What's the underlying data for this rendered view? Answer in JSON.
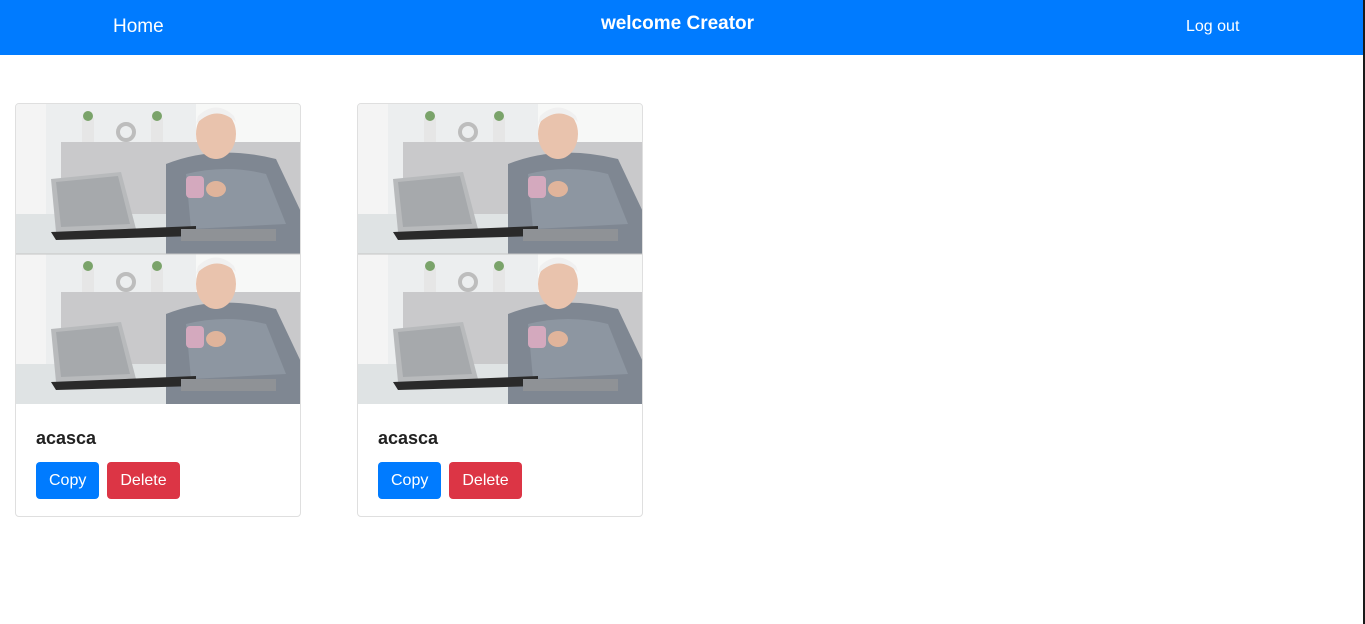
{
  "navbar": {
    "home_label": "Home",
    "title": "welcome Creator",
    "logout_label": "Log out",
    "color": "#007bff"
  },
  "cards": [
    {
      "title": "acasca",
      "image_icon": "meme-image",
      "copy_label": "Copy",
      "delete_label": "Delete"
    },
    {
      "title": "acasca",
      "image_icon": "meme-image",
      "copy_label": "Copy",
      "delete_label": "Delete"
    }
  ],
  "colors": {
    "primary": "#007bff",
    "danger": "#dc3545"
  }
}
